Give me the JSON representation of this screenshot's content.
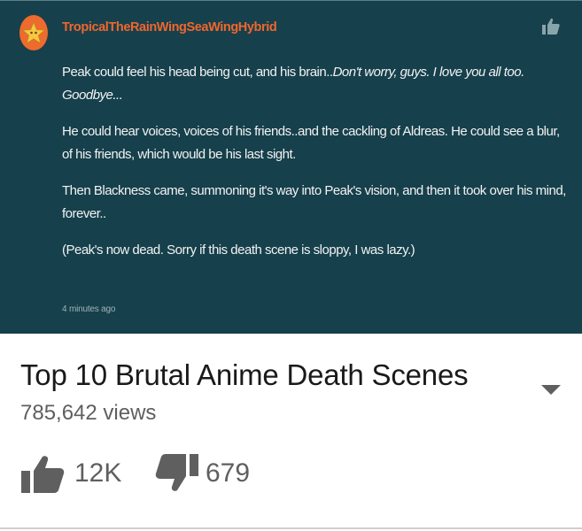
{
  "comment": {
    "username": "TropicalTheRainWingSeaWingHybrid",
    "avatar_icon": "star-avatar-icon",
    "like_icon": "thumbs-up-icon",
    "paragraphs": [
      {
        "text": "Peak could feel his head being cut, and his brain..",
        "italic": "Don't worry, guys. I love you all too. Goodbye..."
      },
      {
        "text": "He could hear voices, voices of his friends..and the cackling of Aldreas. He could see a blur, of his friends, which would be his last sight."
      },
      {
        "text": "Then Blackness came, summoning it's way into Peak's vision, and then it took over his mind, forever.."
      },
      {
        "text": "(Peak's now dead. Sorry if this death scene is sloppy, I was lazy.)"
      }
    ],
    "timestamp": "4 minutes ago"
  },
  "video": {
    "title": "Top 10 Brutal Anime Death Scenes",
    "views": "785,642 views",
    "likes": "12K",
    "dislikes": "679",
    "expand_icon": "chevron-down-icon"
  },
  "colors": {
    "panel_bg": "#16404c",
    "username": "#f0662c",
    "avatar": "#ef6a2e"
  }
}
